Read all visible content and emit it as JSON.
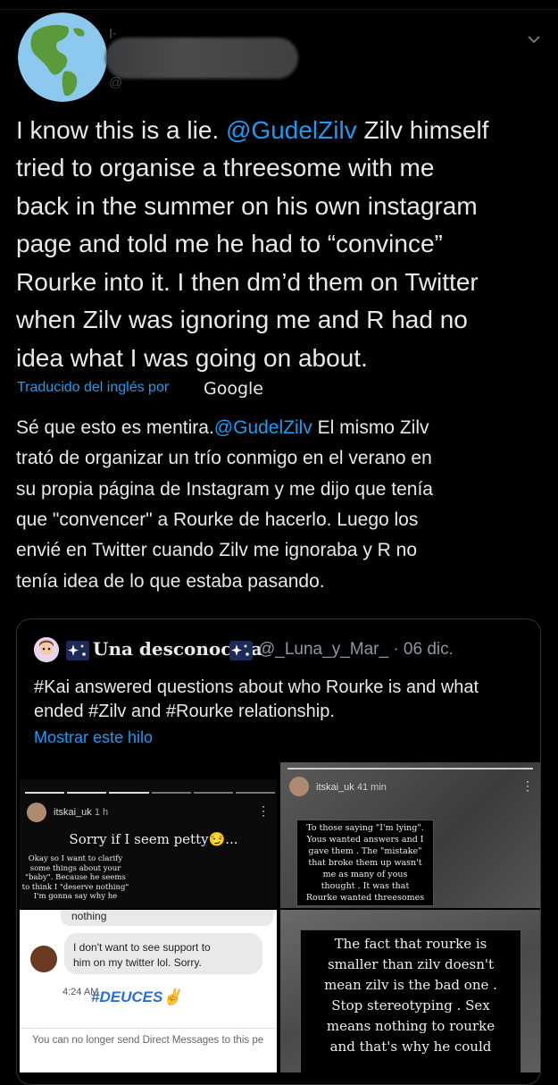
{
  "tweet": {
    "text_parts": {
      "before": "I know this is a lie. ",
      "mention": "@GudelZilv",
      "after": " Zilv himself tried to organise a threesome with me back in the summer on his own instagram page and told me he had to “convince” Rourke into it. I then dm’d them on Twitter when Zilv was ignoring me and R had no idea what I was going on about."
    },
    "lines": [
      "tried to organise a threesome with me",
      "back in the summer on his own instagram",
      "page and told me he had to “convince”",
      "Rourke into it. I then dm’d them on Twitter",
      "when Zilv was ignoring me and R had no",
      "idea what I was going on about."
    ],
    "line1_before": "I know this is a lie. ",
    "line1_mention": "@GudelZilv",
    "line1_after": " Zilv himself",
    "translated_label": "Traducido del inglés por",
    "translated_brand": "Google",
    "translation": {
      "line1_before": "Sé que esto es mentira.",
      "line1_mention": "@GudelZilv",
      "line1_after": " El mismo Zilv",
      "lines": [
        "trató de organizar un trío conmigo en el verano en",
        "su propia página de Instagram y me dijo que tenía",
        "que \"convencer\" a Rourke de hacerlo. Luego los",
        "envié en Twitter cuando Zilv me ignoraba y R no",
        "tenía idea de lo que estaba pasando."
      ]
    }
  },
  "quote": {
    "name": "Una desconocida",
    "handle_date": "@_Luna_y_Mar_ · 06 dic.",
    "text_line1": "#Kai answered questions about who Rourke is and what",
    "text_line2": "ended #Zilv and #Rourke relationship.",
    "show_thread": "Mostrar este hilo"
  },
  "images": {
    "story1": {
      "username": "itskai_uk",
      "time": "1 h",
      "title": "Sorry if I seem petty😏...",
      "body": [
        "Okay so I want to clarify",
        "some things about your",
        "\"baby\". Because he seems",
        "to think I \"deserve nothing\"",
        "I'm gonna say why he"
      ]
    },
    "story2": {
      "username": "itskai_uk",
      "time": "41 min",
      "body": [
        "To those saying \"I'm lying\".",
        "Yous wanted answers and I",
        "gave them . The \"mistake\"",
        "that broke them up wasn't",
        "me as many of yous",
        "thought . It was that",
        "Rourke wanted threesomes"
      ]
    },
    "dm": {
      "bubble_top": "nothing",
      "message_line1": "I don't want to see support to",
      "message_line2": "him on my twitter lol. Sorry.",
      "time": "4:24 AM",
      "sticker": "#DEUCES✌",
      "footer": "You can no longer send Direct Messages to this pe"
    },
    "story3": {
      "body": [
        "The fact that rourke is",
        "smaller than zilv doesn't",
        "mean zilv is the bad one .",
        "Stop stereotyping . Sex",
        "means nothing to rourke",
        "and that's why he could"
      ]
    }
  }
}
